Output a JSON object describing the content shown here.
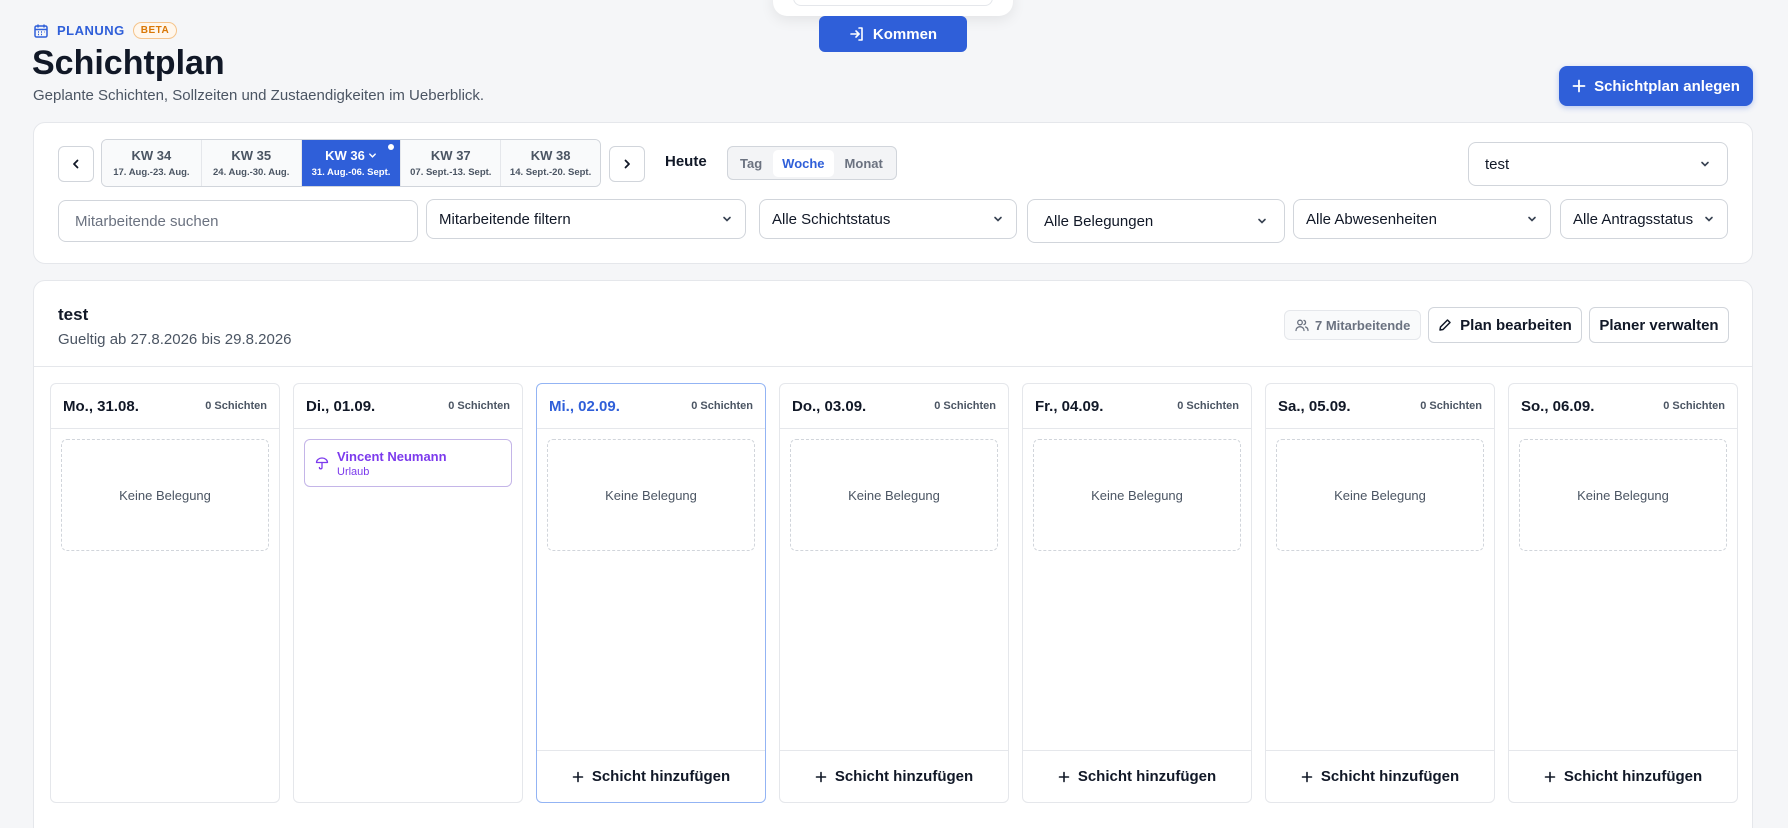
{
  "clock": {
    "button_label": "Kommen"
  },
  "header": {
    "section_label": "PLANUNG",
    "badge": "BETA",
    "title": "Schichtplan",
    "subtitle": "Geplante Schichten, Sollzeiten und Zustaendigkeiten im Ueberblick.",
    "create_button": "Schichtplan anlegen"
  },
  "week_nav": {
    "weeks": [
      {
        "label": "KW 34",
        "range": "17. Aug.-23. Aug."
      },
      {
        "label": "KW 35",
        "range": "24. Aug.-30. Aug."
      },
      {
        "label": "KW 36",
        "range": "31. Aug.-06. Sept.",
        "active": true
      },
      {
        "label": "KW 37",
        "range": "07. Sept.-13. Sept."
      },
      {
        "label": "KW 38",
        "range": "14. Sept.-20. Sept."
      }
    ],
    "today_label": "Heute",
    "views": [
      "Tag",
      "Woche",
      "Monat"
    ],
    "active_view": "Woche",
    "plan_select": "test"
  },
  "filters": {
    "search_placeholder": "Mitarbeitende suchen",
    "employees": "Mitarbeitende filtern",
    "shift_status": "Alle Schichtstatus",
    "assignments": "Alle Belegungen",
    "absences": "Alle Abwesenheiten",
    "request_status": "Alle Antragsstatus"
  },
  "plan": {
    "name": "test",
    "validity": "Gueltig ab 27.8.2026 bis 29.8.2026",
    "employee_count": "7 Mitarbeitende",
    "edit_button": "Plan bearbeiten",
    "manage_button": "Planer verwalten"
  },
  "days": [
    {
      "label": "Mo., 31.08.",
      "count": "0 Schichten",
      "empty": "Keine Belegung"
    },
    {
      "label": "Di., 01.09.",
      "count": "0 Schichten",
      "entry": {
        "name": "Vincent Neumann",
        "type": "Urlaub"
      }
    },
    {
      "label": "Mi., 02.09.",
      "count": "0 Schichten",
      "empty": "Keine Belegung",
      "today": true,
      "add": "Schicht hinzufügen"
    },
    {
      "label": "Do., 03.09.",
      "count": "0 Schichten",
      "empty": "Keine Belegung",
      "add": "Schicht hinzufügen"
    },
    {
      "label": "Fr., 04.09.",
      "count": "0 Schichten",
      "empty": "Keine Belegung",
      "add": "Schicht hinzufügen"
    },
    {
      "label": "Sa., 05.09.",
      "count": "0 Schichten",
      "empty": "Keine Belegung",
      "add": "Schicht hinzufügen"
    },
    {
      "label": "So., 06.09.",
      "count": "0 Schichten",
      "empty": "Keine Belegung",
      "add": "Schicht hinzufügen"
    }
  ],
  "colors": {
    "accent": "#2f5fd9",
    "absence": "#7c3aed",
    "beta": "#d97706"
  }
}
